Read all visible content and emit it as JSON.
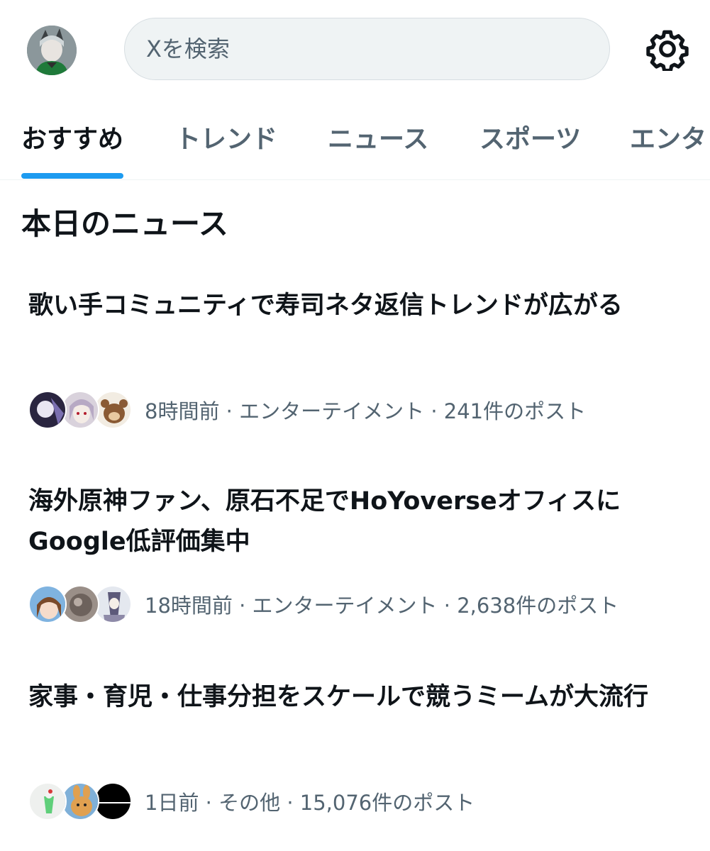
{
  "search": {
    "placeholder": "Xを検索"
  },
  "tabs": [
    {
      "label": "おすすめ",
      "active": true
    },
    {
      "label": "トレンド",
      "active": false
    },
    {
      "label": "ニュース",
      "active": false
    },
    {
      "label": "スポーツ",
      "active": false
    },
    {
      "label": "エンタ",
      "active": false
    }
  ],
  "section": {
    "title": "本日のニュース"
  },
  "news": [
    {
      "headline": "歌い手コミュニティで寿司ネタ返信トレンドが広がる",
      "meta": "8時間前 · エンターテイメント · 241件のポスト"
    },
    {
      "headline": "海外原神ファン、原石不足でHoYoverseオフィスにGoogle低評価集中",
      "meta": "18時間前 · エンターテイメント · 2,638件のポスト"
    },
    {
      "headline": "家事・育児・仕事分担をスケールで競うミームが大流行",
      "meta": "1日前 · その他 · 15,076件のポスト"
    }
  ],
  "icons": {
    "settings": "gear-icon",
    "profile": "avatar"
  },
  "colors": {
    "accent": "#1d9bf0",
    "text": "#0f1419",
    "secondary": "#536471"
  }
}
